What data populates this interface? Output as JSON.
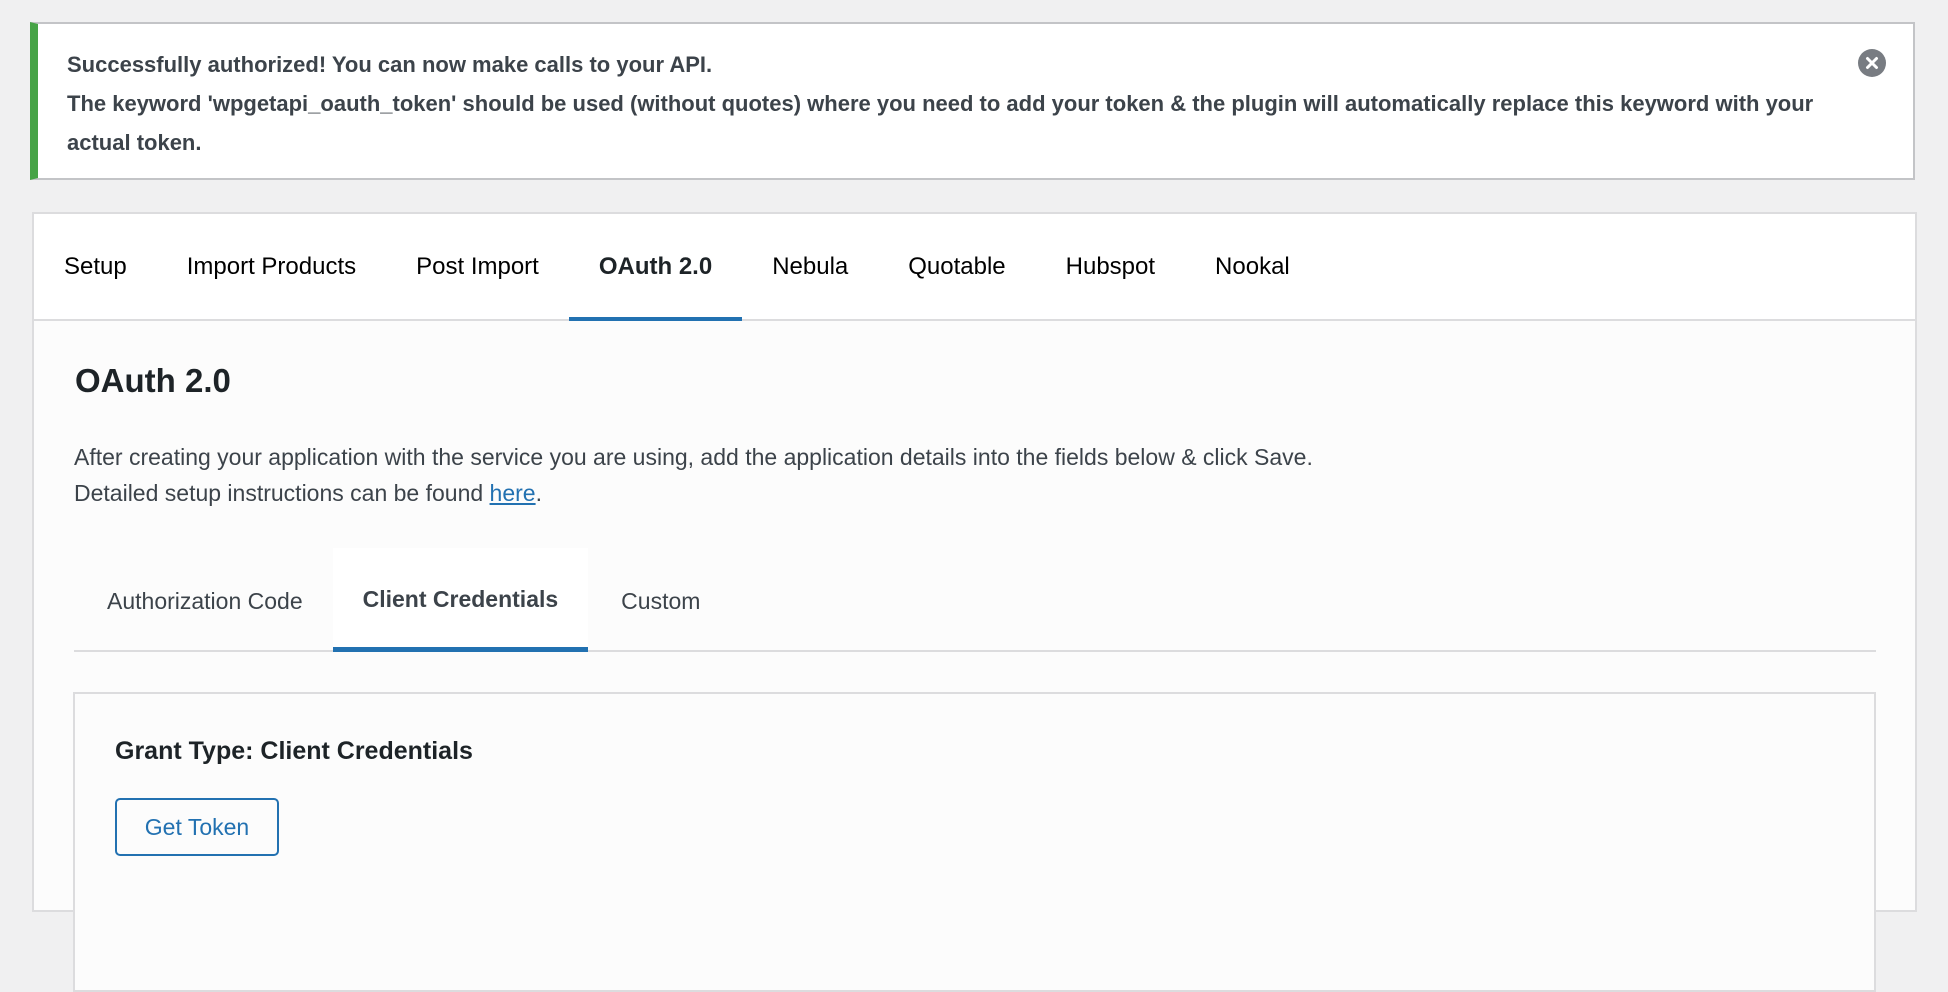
{
  "notice": {
    "type": "success",
    "lines": [
      "Successfully authorized! You can now make calls to your API.",
      "The keyword 'wpgetapi_oauth_token' should be used (without quotes) where you need to add your token & the plugin will automatically replace this keyword with your actual token."
    ],
    "dismiss_icon": "close-circle-icon",
    "accent_color": "#46a346"
  },
  "tabs": [
    {
      "label": "Setup",
      "active": false
    },
    {
      "label": "Import Products",
      "active": false
    },
    {
      "label": "Post Import",
      "active": false
    },
    {
      "label": "OAuth 2.0",
      "active": true
    },
    {
      "label": "Nebula",
      "active": false
    },
    {
      "label": "Quotable",
      "active": false
    },
    {
      "label": "Hubspot",
      "active": false
    },
    {
      "label": "Nookal",
      "active": false
    }
  ],
  "page": {
    "title": "OAuth 2.0",
    "description_line1": "After creating your application with the service you are using, add the application details into the fields below & click Save.",
    "description_line2_prefix": "Detailed setup instructions can be found ",
    "description_link": "here",
    "description_line2_suffix": "."
  },
  "subtabs": [
    {
      "label": "Authorization Code",
      "active": false
    },
    {
      "label": "Client Credentials",
      "active": true
    },
    {
      "label": "Custom",
      "active": false
    }
  ],
  "grant": {
    "title": "Grant Type: Client Credentials",
    "button_label": "Get Token"
  },
  "colors": {
    "accent": "#2271b1",
    "success": "#46a346",
    "background": "#f0f0f1"
  }
}
